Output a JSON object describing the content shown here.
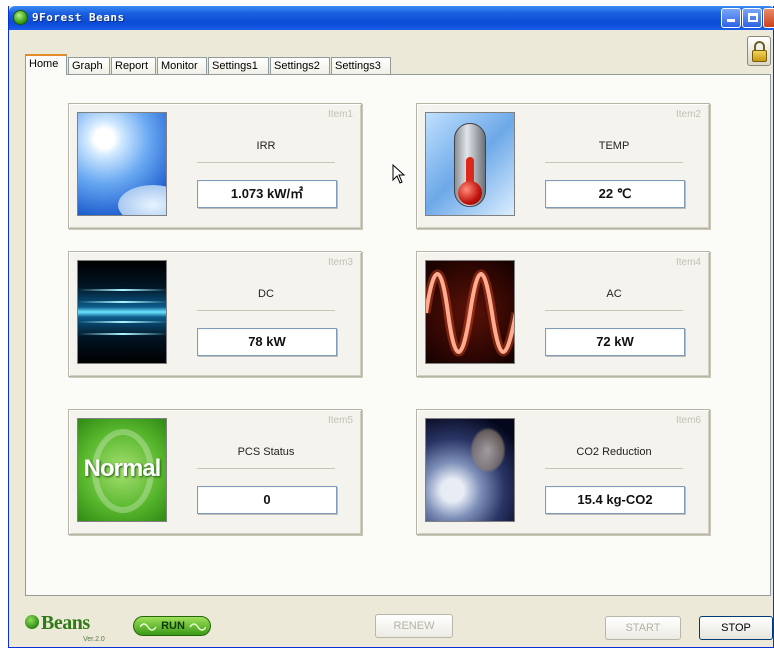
{
  "window": {
    "title": "9Forest Beans"
  },
  "tabs": [
    {
      "label": "Home",
      "active": true
    },
    {
      "label": "Graph",
      "active": false
    },
    {
      "label": "Report",
      "active": false
    },
    {
      "label": "Monitor",
      "active": false
    },
    {
      "label": "Settings1",
      "active": false
    },
    {
      "label": "Settings2",
      "active": false
    },
    {
      "label": "Settings3",
      "active": false
    }
  ],
  "items": [
    {
      "tag": "Item1",
      "name": "IRR",
      "value": "1.073  kW/㎡",
      "icon": "sun-sky-icon"
    },
    {
      "tag": "Item2",
      "name": "TEMP",
      "value": "22  ℃",
      "icon": "thermometer-icon"
    },
    {
      "tag": "Item3",
      "name": "DC",
      "value": "78  kW",
      "icon": "dc-light-lines-icon"
    },
    {
      "tag": "Item4",
      "name": "AC",
      "value": "72  kW",
      "icon": "ac-sine-wave-icon"
    },
    {
      "tag": "Item5",
      "name": "PCS Status",
      "value": "0",
      "icon": "normal-status-icon",
      "icon_text": "Normal"
    },
    {
      "tag": "Item6",
      "name": "CO2 Reduction",
      "value": "15.4  kg-CO2",
      "icon": "earth-icon"
    }
  ],
  "footer": {
    "logo_text": "Beans",
    "version": "Ver.2.0",
    "run_label": "RUN",
    "renew_label": "RENEW",
    "start_label": "START",
    "stop_label": "STOP"
  },
  "colors": {
    "titlebar": "#0b4ad6",
    "active_tab_accent": "#e68b2c",
    "run_green": "#3a9a16"
  }
}
